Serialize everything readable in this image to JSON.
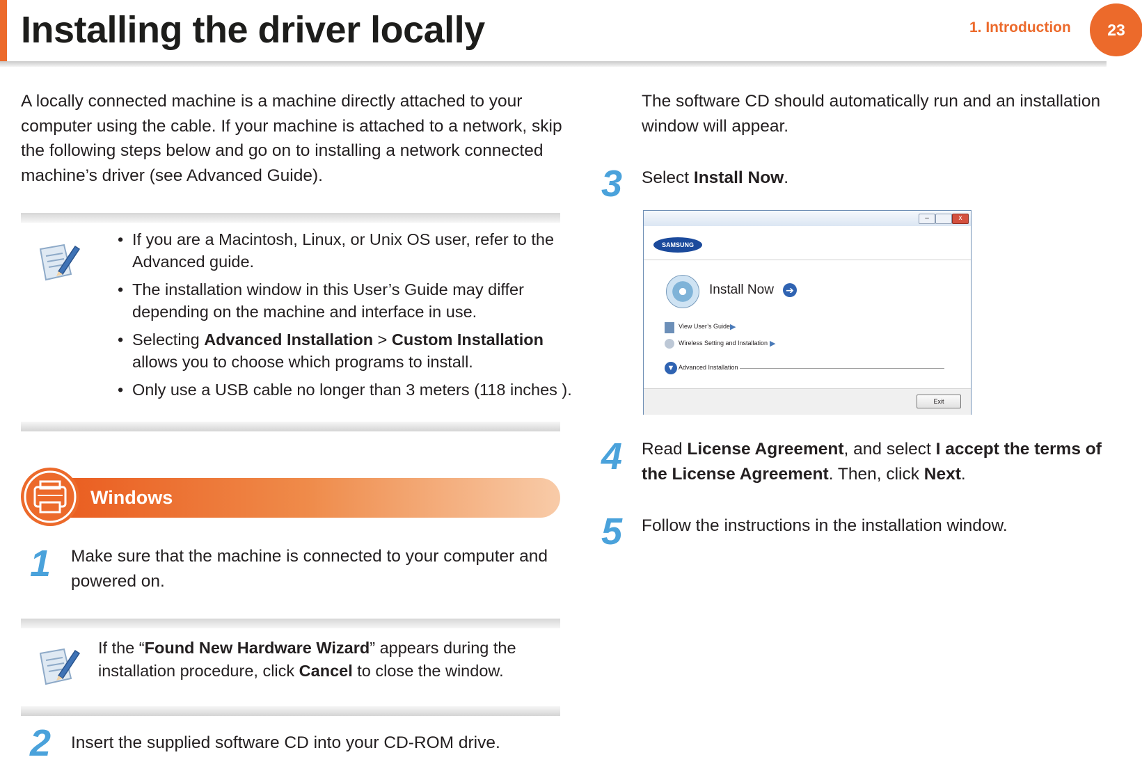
{
  "header": {
    "title": "Installing the driver locally",
    "chapter": "1.  Introduction",
    "page_number": "23"
  },
  "intro": {
    "text": "A locally connected machine is a machine directly attached to your computer using the cable. If your machine is attached to a network, skip the following steps below and go on to installing a network connected machine’s driver (see Advanced Guide)."
  },
  "note1": {
    "bullet": "•",
    "items": [
      {
        "before": "If you are a Macintosh, Linux, or Unix OS user, refer to the Advanced guide."
      },
      {
        "before": "The installation window in this User’s Guide may differ depending on the machine and interface in use."
      },
      {
        "before": "Selecting ",
        "bold1": "Advanced Installation",
        "mid": " > ",
        "bold2": "Custom Installation",
        "after": " allows you to choose which programs to install."
      },
      {
        "before": "Only use a USB cable no longer than 3 meters (118 inches )."
      }
    ]
  },
  "section": {
    "title": "Windows"
  },
  "steps": {
    "s1": {
      "num": "1",
      "text": "Make sure that the machine is connected to your computer and powered on."
    },
    "s2": {
      "num": "2",
      "text": "Insert the supplied software CD into your CD-ROM drive."
    },
    "s2_cont": {
      "text": "The software CD should automatically run and an installation window will appear."
    },
    "s3": {
      "num": "3",
      "before": "Select ",
      "bold": "Install Now",
      "after": "."
    },
    "s4": {
      "num": "4",
      "before": "Read ",
      "bold1": "License Agreement",
      "mid": ", and select ",
      "bold2": "I accept the terms of the License Agreement",
      "mid2": ". Then, click ",
      "bold3": "Next",
      "after": "."
    },
    "s5": {
      "num": "5",
      "text": "Follow the instructions in the installation window."
    }
  },
  "note2": {
    "before": "If the “",
    "bold1": "Found New Hardware Wizard",
    "mid": "” appears during the installation procedure, click ",
    "bold2": "Cancel",
    "after": " to close the window."
  },
  "screenshot": {
    "brand": "SAMSUNG",
    "install_now": "Install Now",
    "view_guide": "View User’s Guide",
    "wireless": "Wireless Setting and Installation",
    "advanced": "Advanced Installation",
    "exit": "Exit"
  },
  "colors": {
    "accent": "#ec6a2b",
    "step_blue": "#4aa2db"
  }
}
